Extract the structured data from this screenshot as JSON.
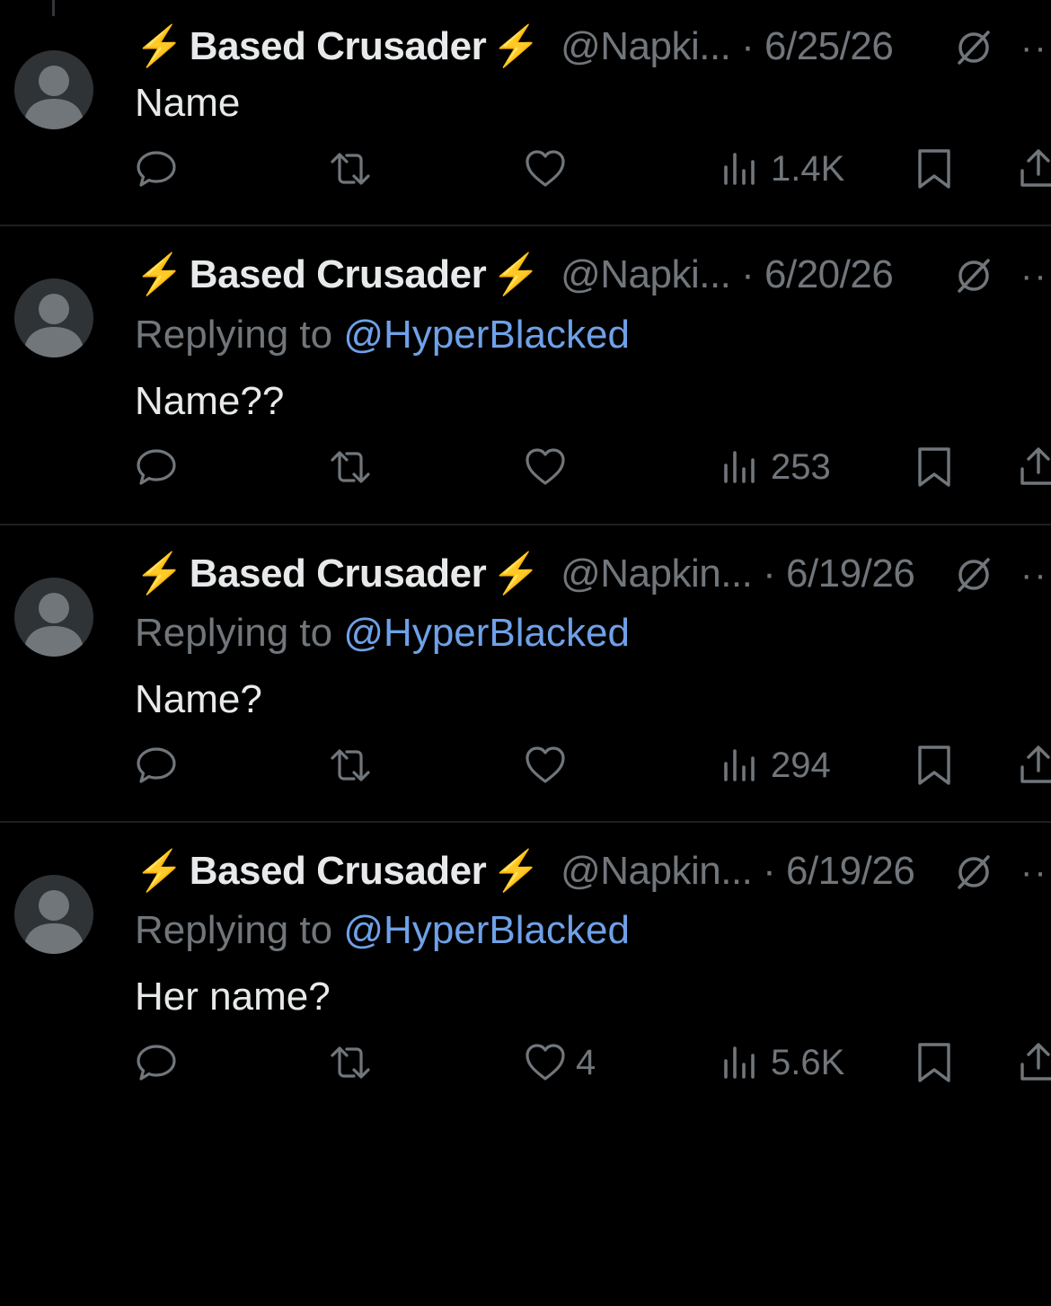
{
  "posts": [
    {
      "display_name": "Based Crusader",
      "handle_date": "@Napki... · 6/25/26",
      "replying_label": "",
      "replying_to": "",
      "text": "Name",
      "likes": "",
      "views": "1.4K"
    },
    {
      "display_name": "Based Crusader",
      "handle_date": "@Napki... · 6/20/26",
      "replying_label": "Replying to",
      "replying_to": "@HyperBlacked",
      "text": "Name??",
      "likes": "",
      "views": "253"
    },
    {
      "display_name": "Based Crusader",
      "handle_date": "@Napkin... · 6/19/26",
      "replying_label": "Replying to",
      "replying_to": "@HyperBlacked",
      "text": "Name?",
      "likes": "",
      "views": "294"
    },
    {
      "display_name": "Based Crusader",
      "handle_date": "@Napkin... · 6/19/26",
      "replying_label": "Replying to",
      "replying_to": "@HyperBlacked",
      "text": "Her name?",
      "likes": "4",
      "views": "5.6K"
    }
  ],
  "icons": {
    "bolt": "⚡",
    "reply": "reply-icon",
    "repost": "repost-icon",
    "like": "heart-icon",
    "views": "views-icon",
    "bookmark": "bookmark-icon",
    "share": "share-icon",
    "grok": "grok-icon",
    "more": "more-icon"
  },
  "colors": {
    "background": "#000000",
    "text": "#e7e9ea",
    "muted": "#71767b",
    "mention": "#6fa1e8",
    "bolt": "#f7c948"
  }
}
